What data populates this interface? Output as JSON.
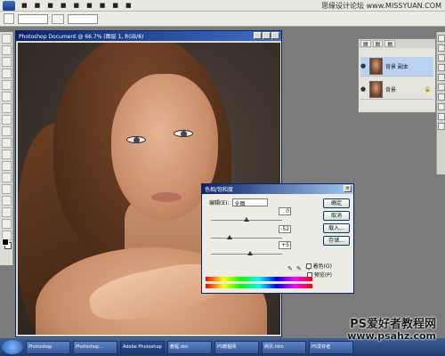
{
  "watermark_top": "思缘设计论坛  www.MISSYUAN.COM",
  "watermark_bottom": {
    "line1": "PS爱好者教程网",
    "line2": "www.psahz.com"
  },
  "document": {
    "title": "Photoshop Document @ 66.7% (图层 1, RGB/8)"
  },
  "dialog": {
    "title": "色相/饱和度",
    "edit_label": "编辑(E):",
    "edit_value": "全图",
    "hue_value": "0",
    "saturation_value": "-52",
    "lightness_value": "+5",
    "buttons": {
      "ok": "确定",
      "cancel": "取消",
      "load": "载入...",
      "save": "存储..."
    },
    "colorize_label": "着色(O)",
    "preview_label": "预览(P)"
  },
  "layers_panel": {
    "layers": [
      {
        "name": "背景 副本"
      },
      {
        "name": "背景",
        "locked_icon": "lock-icon"
      }
    ]
  },
  "taskbar": {
    "items": [
      "Photoshop",
      "Photoshop...",
      "Adobe Photoshop",
      "教程.doc",
      "PS教程网",
      "网页.htm",
      "PS爱好者"
    ]
  },
  "colors": {
    "title_blue": "#0a246a",
    "taskbar_blue": "#2a4f92"
  }
}
